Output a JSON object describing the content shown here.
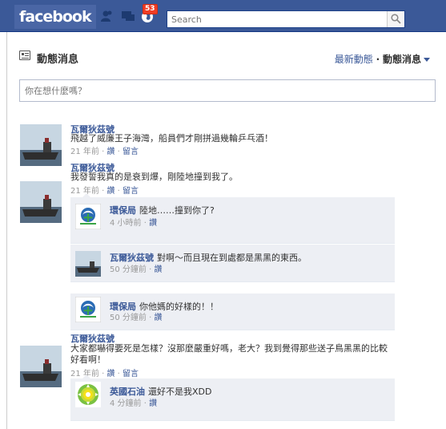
{
  "topbar": {
    "logo": "facebook",
    "notifications_count": "53",
    "search_placeholder": "Search",
    "bg_color": "#3b5998"
  },
  "header": {
    "title": "動態消息",
    "sort_recent": "最新動態",
    "sort_separator": "·",
    "sort_top": "動態消息"
  },
  "composer": {
    "placeholder": "你在想什麼嗎？"
  },
  "stories": [
    {
      "author": "瓦爾狄茲號",
      "text": "飛越了威廉王子海灣，船員們才剛拼過幾輪乒乓酒！",
      "time": "21 年前",
      "sep": "·",
      "like": "讚",
      "comment": "留言"
    },
    {
      "author": "瓦爾狄茲號",
      "text": "我發誓我真的是衰到爆，剛陸地撞到我了。",
      "time": "21 年前",
      "sep": "·",
      "like": "讚",
      "comment": "留言",
      "comments": [
        {
          "author": "環保局",
          "text": "陸地……撞到你了?",
          "time": "4 小時前",
          "like": "讚"
        },
        {
          "author": "瓦爾狄茲號",
          "text": "對啊～而且現在到處都是黑黑的東西。",
          "time": "50 分鐘前",
          "like": "讚"
        },
        {
          "author": "環保局",
          "text": "你他媽的好樣的！！",
          "time": "50 分鐘前",
          "like": "讚"
        }
      ]
    },
    {
      "author": "瓦爾狄茲號",
      "text_line1": "大家都嚇得要死是怎樣？沒那麼嚴重好嗎，老大？我到覺得那些送子鳥黑黑的比較",
      "text_line2": "好看啊！",
      "time": "21 年前",
      "sep": "·",
      "like": "讚",
      "comment": "留言",
      "comments": [
        {
          "author": "英國石油",
          "text": "還好不是我XDD",
          "time": "4 分鐘前",
          "like": "讚"
        }
      ]
    }
  ]
}
